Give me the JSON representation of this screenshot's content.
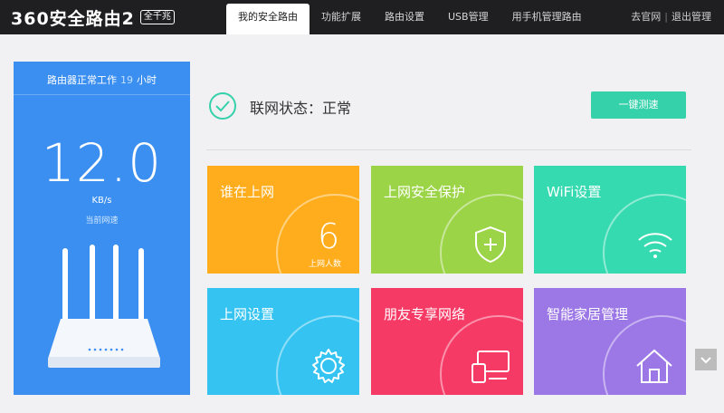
{
  "header": {
    "logo_text": "360安全路由2",
    "logo_badge": "全千兆",
    "nav": [
      {
        "label": "我的安全路由",
        "active": true
      },
      {
        "label": "功能扩展"
      },
      {
        "label": "路由设置"
      },
      {
        "label": "USB管理"
      },
      {
        "label": "用手机管理路由"
      }
    ],
    "links": {
      "official": "去官网",
      "separator": "|",
      "logout": "退出管理"
    }
  },
  "status_panel": {
    "uptime_prefix": "路由器正常工作",
    "uptime_hours": "19",
    "uptime_suffix": "小时",
    "speed_value": "12.0",
    "speed_unit": "KB/s",
    "speed_label": "当前网速"
  },
  "connection": {
    "status_text": "联网状态：正常",
    "speedtest_button": "一键测速"
  },
  "tiles": [
    {
      "title": "谁在上网",
      "count": "6",
      "count_label": "上网人数",
      "icon": "online-count"
    },
    {
      "title": "上网安全保护",
      "icon": "shield-plus-icon"
    },
    {
      "title": "WiFi设置",
      "icon": "wifi-icon"
    },
    {
      "title": "上网设置",
      "icon": "gear-icon"
    },
    {
      "title": "朋友专享网络",
      "icon": "devices-icon"
    },
    {
      "title": "智能家居管理",
      "icon": "home-icon"
    }
  ],
  "colors": {
    "topbar": "#1f1f21",
    "panel_blue": "#3b8ff0",
    "accent_green": "#35d1aa",
    "tile_orange": "#ffad1c",
    "tile_lime": "#9cd447",
    "tile_teal": "#36dab0",
    "tile_sky": "#35c4f1",
    "tile_red": "#f63a66",
    "tile_purple": "#9c77e6"
  }
}
